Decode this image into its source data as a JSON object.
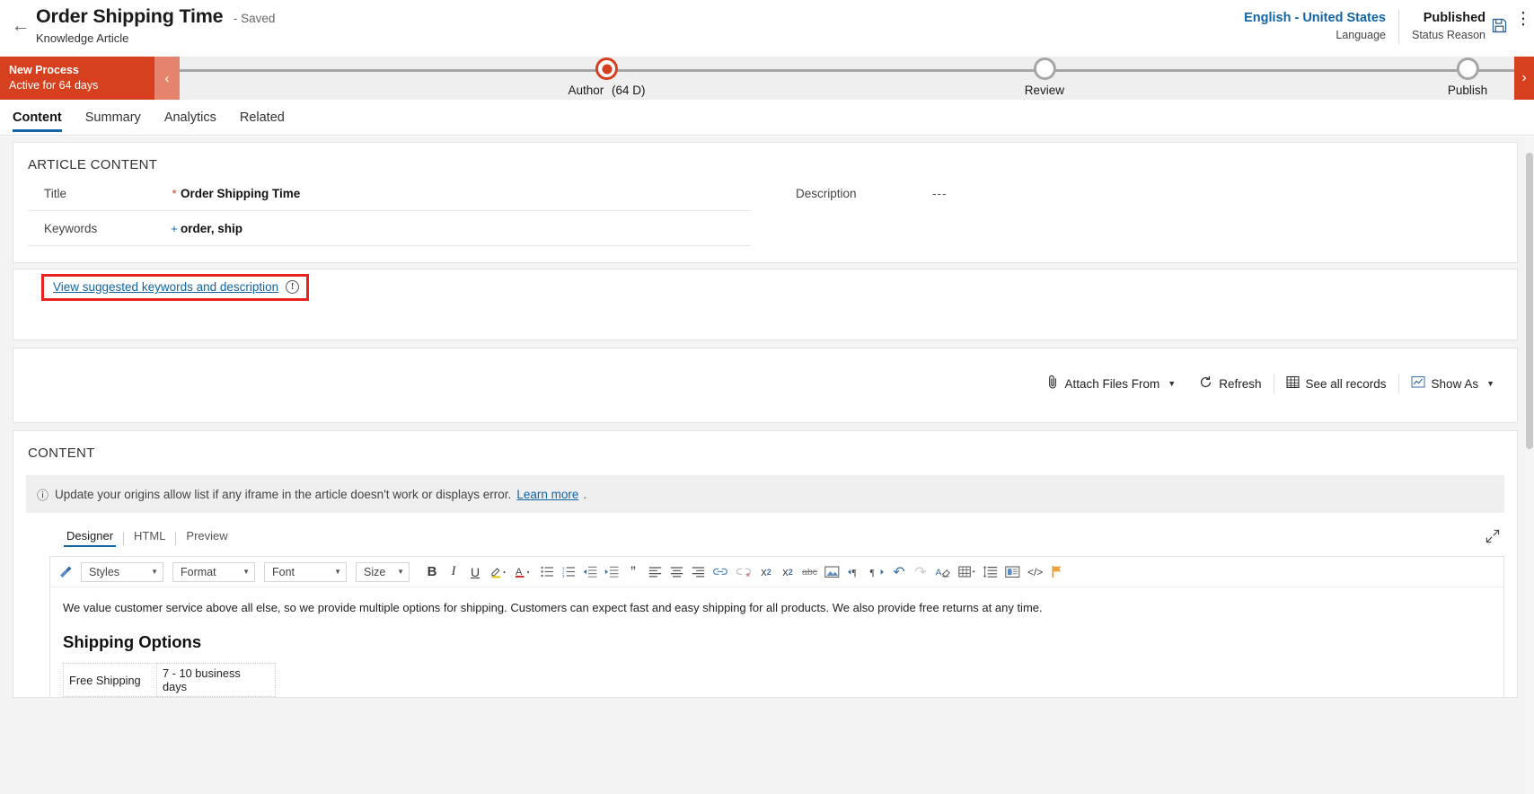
{
  "header": {
    "back_icon": "back-arrow-icon",
    "title": "Order Shipping Time",
    "saved_state": "- Saved",
    "entity": "Knowledge Article",
    "language_value": "English - United States",
    "language_label": "Language",
    "status_value": "Published",
    "status_label": "Status Reason",
    "save_icon": "save-floppy-icon",
    "more_icon": "kebab-more-icon"
  },
  "process": {
    "stage_name": "New Process",
    "stage_duration": "Active for 64 days",
    "collapse_icon": "chevron-left-icon",
    "next_icon": "chevron-right-icon",
    "stages": [
      {
        "label": "Author",
        "duration": "(64 D)",
        "state": "active"
      },
      {
        "label": "Review",
        "duration": "",
        "state": "pending"
      },
      {
        "label": "Publish",
        "duration": "",
        "state": "pending"
      }
    ]
  },
  "tabs": [
    {
      "label": "Content",
      "active": true
    },
    {
      "label": "Summary",
      "active": false
    },
    {
      "label": "Analytics",
      "active": false
    },
    {
      "label": "Related",
      "active": false
    }
  ],
  "article_content": {
    "section_title": "ARTICLE CONTENT",
    "fields_left": [
      {
        "label": "Title",
        "required": "*",
        "required_type": "star",
        "value": "Order Shipping Time"
      },
      {
        "label": "Keywords",
        "required": "+",
        "required_type": "plus",
        "value": "order, ship"
      }
    ],
    "fields_right": [
      {
        "label": "Description",
        "required": "",
        "required_type": "none",
        "value": "---"
      }
    ]
  },
  "suggestion": {
    "link_text": "View suggested keywords and description",
    "info_icon": "info-circle-icon",
    "info_glyph": "!"
  },
  "attachments_toolbar": {
    "items": [
      {
        "icon": "paperclip-icon",
        "label": "Attach Files From",
        "has_chevron": true
      },
      {
        "icon": "refresh-icon",
        "label": "Refresh",
        "has_chevron": false
      },
      {
        "icon": "grid-table-icon",
        "label": "See all records",
        "has_chevron": false
      },
      {
        "icon": "chart-image-icon",
        "label": "Show As",
        "has_chevron": true
      }
    ]
  },
  "content_section": {
    "section_title": "CONTENT",
    "notice": {
      "icon": "info-circle-icon",
      "text": "Update your origins allow list if any iframe in the article doesn't work or displays error.",
      "link": "Learn more",
      "trailing": "."
    },
    "editor_tabs": [
      {
        "label": "Designer",
        "active": true
      },
      {
        "label": "HTML",
        "active": false
      },
      {
        "label": "Preview",
        "active": false
      }
    ],
    "expand_icon": "expand-diagonal-icon",
    "toolbar": {
      "selects": [
        {
          "name": "styles-select",
          "value": "Styles"
        },
        {
          "name": "format-select",
          "value": "Format"
        },
        {
          "name": "font-select",
          "value": "Font"
        },
        {
          "name": "size-select",
          "value": "Size"
        }
      ],
      "buttons": [
        {
          "name": "format-painter-icon",
          "glyph": "🖌"
        },
        {
          "name": "bold-icon",
          "glyph": "B"
        },
        {
          "name": "italic-icon",
          "glyph": "I"
        },
        {
          "name": "underline-icon",
          "glyph": "U"
        },
        {
          "name": "highlight-color-icon",
          "glyph": "✎"
        },
        {
          "name": "font-color-icon",
          "glyph": "A"
        },
        {
          "name": "bulleted-list-icon",
          "glyph": "☰"
        },
        {
          "name": "numbered-list-icon",
          "glyph": "☷"
        },
        {
          "name": "decrease-indent-icon",
          "glyph": "⇤"
        },
        {
          "name": "increase-indent-icon",
          "glyph": "⇥"
        },
        {
          "name": "blockquote-icon",
          "glyph": "”"
        },
        {
          "name": "align-left-icon",
          "glyph": "≡"
        },
        {
          "name": "align-center-icon",
          "glyph": "≡"
        },
        {
          "name": "align-right-icon",
          "glyph": "≡"
        },
        {
          "name": "insert-link-icon",
          "glyph": "⚭"
        },
        {
          "name": "remove-link-icon",
          "glyph": "⚮"
        },
        {
          "name": "superscript-icon",
          "glyph": "x²"
        },
        {
          "name": "subscript-icon",
          "glyph": "x₂"
        },
        {
          "name": "strikethrough-icon",
          "glyph": "abc"
        },
        {
          "name": "insert-image-icon",
          "glyph": "ὛC"
        },
        {
          "name": "ltr-direction-icon",
          "glyph": "¶"
        },
        {
          "name": "rtl-direction-icon",
          "glyph": "¶"
        },
        {
          "name": "undo-icon",
          "glyph": "↶"
        },
        {
          "name": "redo-icon",
          "glyph": "↷"
        },
        {
          "name": "clear-formatting-icon",
          "glyph": "A"
        },
        {
          "name": "insert-table-icon",
          "glyph": "▦"
        },
        {
          "name": "line-height-icon",
          "glyph": "≣"
        },
        {
          "name": "insert-template-icon",
          "glyph": "⧉"
        },
        {
          "name": "source-code-icon",
          "glyph": "</>"
        },
        {
          "name": "flag-icon",
          "glyph": "⚑"
        }
      ]
    },
    "document": {
      "paragraph": "We value customer service above all else, so we provide multiple options for shipping. Customers can expect fast and easy shipping for all products. We also provide free returns at any time.",
      "heading": "Shipping Options",
      "table_rows": [
        [
          "Free Shipping",
          "7 - 10 business days"
        ]
      ]
    }
  },
  "colors": {
    "accent_red": "#d6401e",
    "link_blue": "#1264a3",
    "highlight_red": "#e8221f"
  }
}
